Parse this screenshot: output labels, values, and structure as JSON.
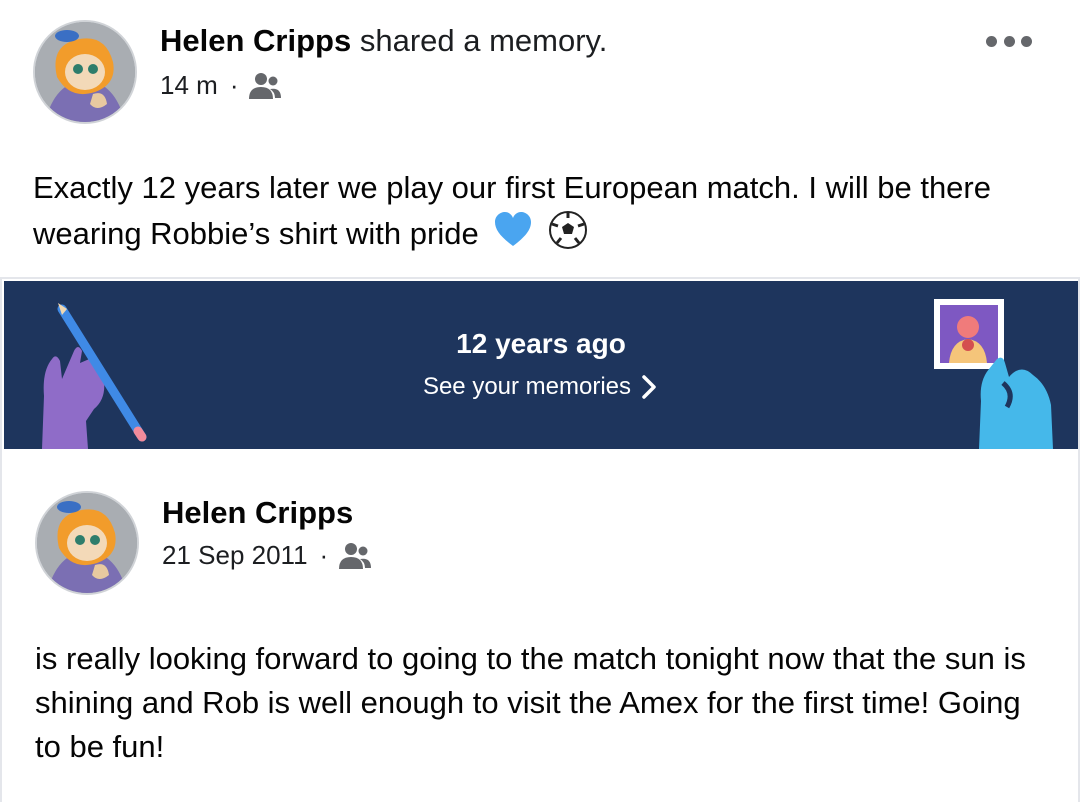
{
  "post": {
    "author": "Helen Cripps",
    "action": "shared a memory.",
    "time": "14 m",
    "separator": "·",
    "privacy_icon": "friends-icon",
    "more_icon": "more-horizontal-icon",
    "text": "Exactly 12 years later we play our first European match. I will be there wearing Robbie’s shirt with pride",
    "emojis": [
      "blue-heart-icon",
      "soccer-ball-icon"
    ]
  },
  "memory_banner": {
    "title": "12 years ago",
    "link_label": "See your memories",
    "link_icon": "chevron-right-icon",
    "background_color": "#1e355d"
  },
  "original_post": {
    "author": "Helen Cripps",
    "date": "21 Sep 2011",
    "separator": "·",
    "privacy_icon": "friends-icon",
    "text": "is really looking forward to going to the match tonight now that the sun is shining and Rob is well enough to visit the Amex for the first time! Going to be fun!"
  }
}
